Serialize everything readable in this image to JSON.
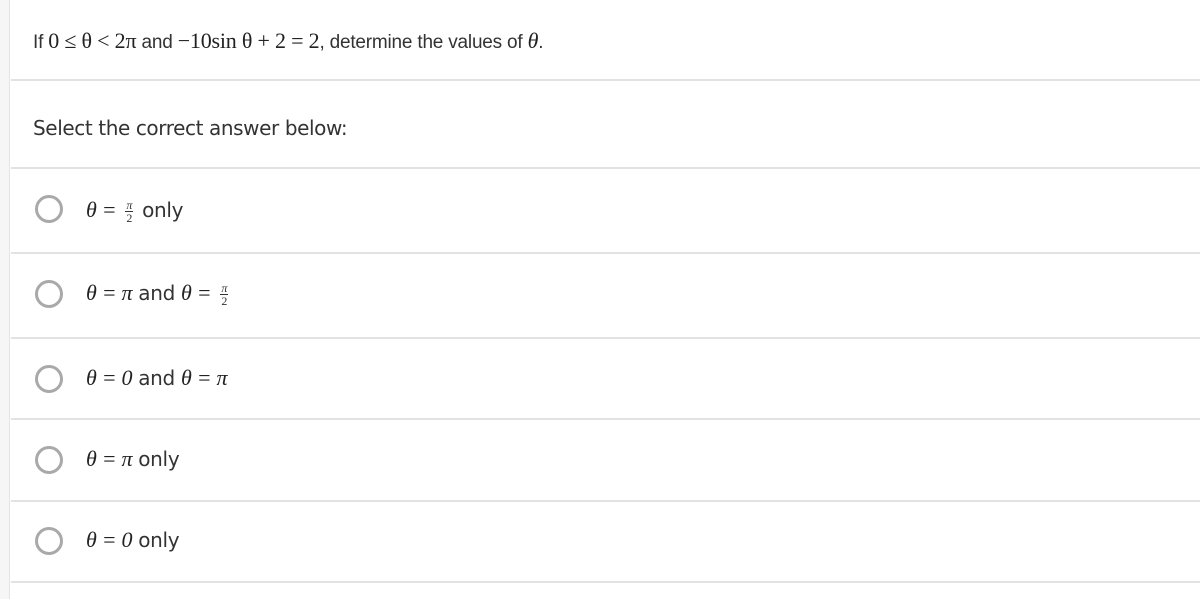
{
  "question": {
    "prefix": "If",
    "math1": "0 ≤ θ < 2π",
    "and": "and",
    "math2": "−10sin θ + 2 = 2",
    "suffix": ", determine the values of",
    "math3": "θ",
    "end": "."
  },
  "prompt": "Select the correct answer below:",
  "options": [
    {
      "math_a": "θ =",
      "frac_num": "π",
      "frac_den": "2",
      "text": "only",
      "selected": false
    },
    {
      "math_a": "θ = π",
      "text_mid": "and",
      "math_b": "θ =",
      "frac_num": "π",
      "frac_den": "2",
      "selected": false
    },
    {
      "math_a": "θ = 0",
      "text_mid": "and",
      "math_b": "θ = π",
      "selected": false
    },
    {
      "math_a": "θ = π",
      "text": "only",
      "selected": false
    },
    {
      "math_a": "θ = 0",
      "text": "only",
      "selected": false
    }
  ],
  "colors": {
    "divider": "#e2e2e2",
    "radio_border": "#a9a9a9",
    "text": "#333333",
    "left_strip": "#f6f6f6"
  }
}
